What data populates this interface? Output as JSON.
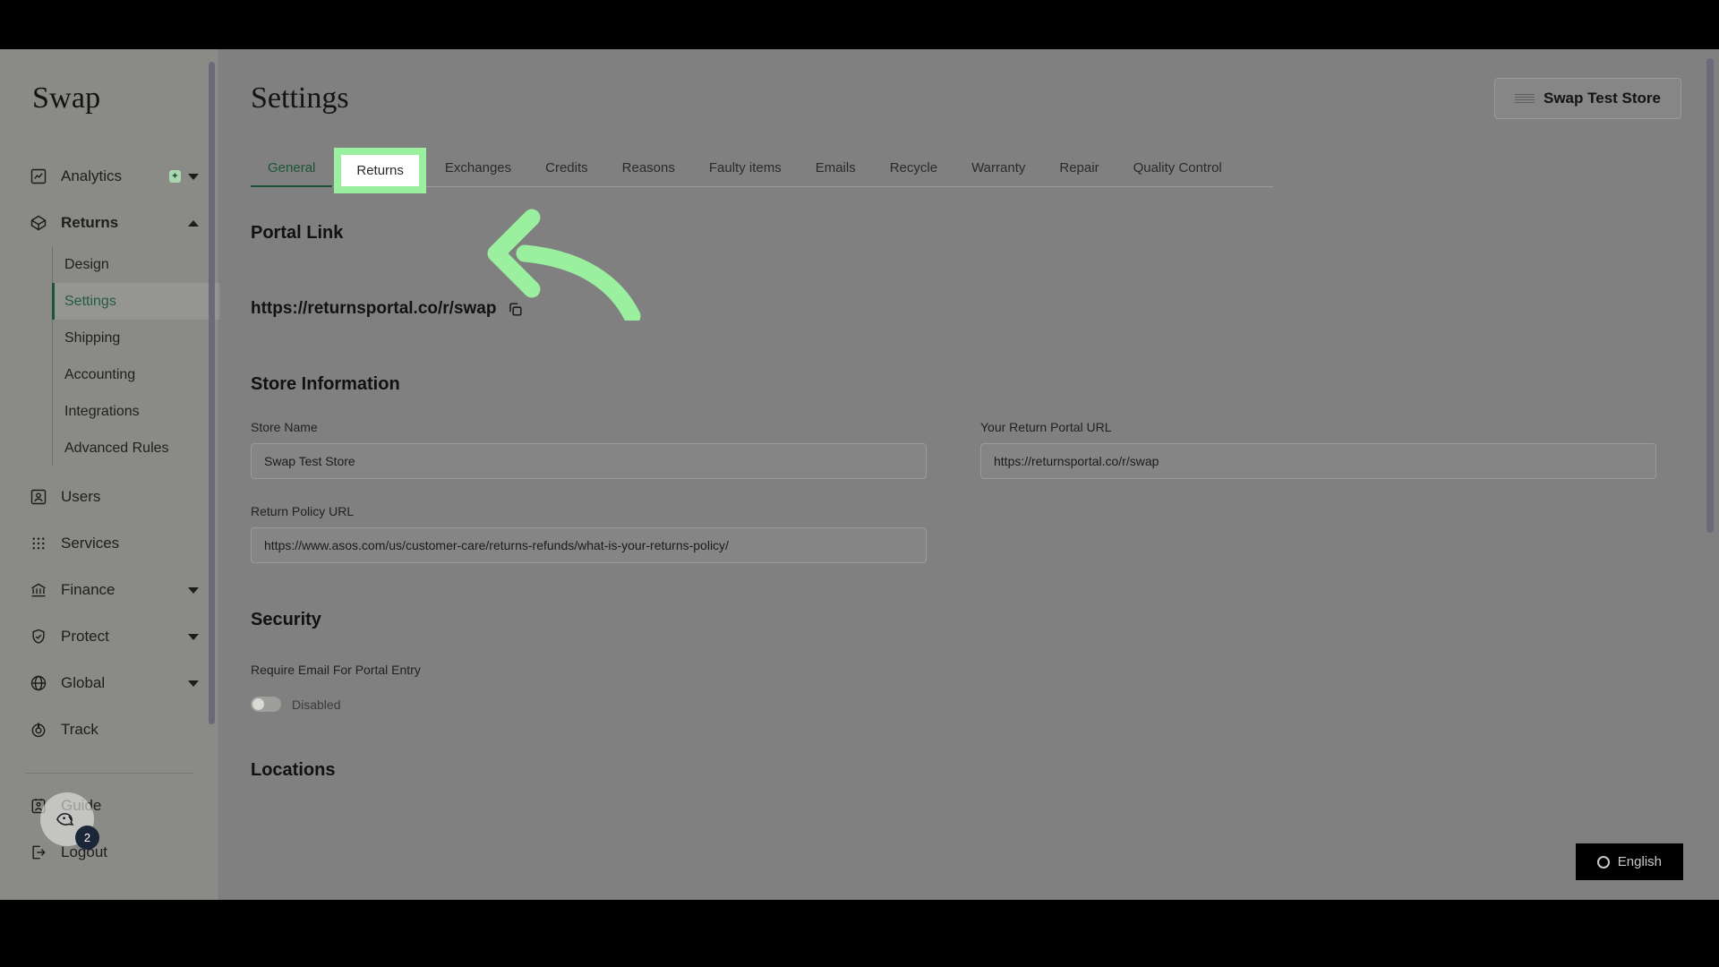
{
  "app": {
    "brand": "Swap"
  },
  "sidebar": {
    "items": [
      {
        "label": "Analytics",
        "icon": "chart-icon",
        "badge": "sparkle",
        "expandable": true,
        "expanded": false,
        "bold": false
      },
      {
        "label": "Returns",
        "icon": "package-icon",
        "expandable": true,
        "expanded": true,
        "bold": true
      }
    ],
    "returns_submenu": [
      {
        "label": "Design",
        "active": false
      },
      {
        "label": "Settings",
        "active": true
      },
      {
        "label": "Shipping",
        "active": false
      },
      {
        "label": "Accounting",
        "active": false
      },
      {
        "label": "Integrations",
        "active": false
      },
      {
        "label": "Advanced Rules",
        "active": false
      }
    ],
    "items_lower": [
      {
        "label": "Users",
        "icon": "user-card-icon",
        "expandable": false
      },
      {
        "label": "Services",
        "icon": "grid-dots-icon",
        "expandable": false
      },
      {
        "label": "Finance",
        "icon": "bank-icon",
        "expandable": true
      },
      {
        "label": "Protect",
        "icon": "shield-check-icon",
        "expandable": true
      },
      {
        "label": "Global",
        "icon": "globe-icon",
        "expandable": true
      },
      {
        "label": "Track",
        "icon": "track-icon",
        "expandable": false
      }
    ],
    "bottom_items": [
      {
        "label": "Guide",
        "icon": "guide-icon"
      },
      {
        "label": "Logout",
        "icon": "logout-icon"
      }
    ]
  },
  "header": {
    "title": "Settings",
    "store_button_label": "Swap Test Store"
  },
  "tabs": [
    {
      "label": "General",
      "active": true,
      "highlight": false
    },
    {
      "label": "Returns",
      "active": false,
      "highlight": true
    },
    {
      "label": "Exchanges",
      "active": false,
      "highlight": false
    },
    {
      "label": "Credits",
      "active": false,
      "highlight": false
    },
    {
      "label": "Reasons",
      "active": false,
      "highlight": false
    },
    {
      "label": "Faulty items",
      "active": false,
      "highlight": false
    },
    {
      "label": "Emails",
      "active": false,
      "highlight": false
    },
    {
      "label": "Recycle",
      "active": false,
      "highlight": false
    },
    {
      "label": "Warranty",
      "active": false,
      "highlight": false
    },
    {
      "label": "Repair",
      "active": false,
      "highlight": false
    },
    {
      "label": "Quality Control",
      "active": false,
      "highlight": false
    }
  ],
  "main": {
    "portal_link": {
      "heading": "Portal Link",
      "url": "https://returnsportal.co/r/swap",
      "copy_icon": "copy-icon"
    },
    "store_information": {
      "heading": "Store Information",
      "fields": [
        {
          "label": "Store Name",
          "value": "Swap Test Store"
        },
        {
          "label": "Your Return Portal URL",
          "value": "https://returnsportal.co/r/swap"
        },
        {
          "label": "Return Policy URL",
          "value": "https://www.asos.com/us/customer-care/returns-refunds/what-is-your-returns-policy/"
        }
      ]
    },
    "security": {
      "heading": "Security",
      "toggle_label": "Require Email For Portal Entry",
      "toggle_state": "Disabled"
    },
    "locations": {
      "heading": "Locations"
    }
  },
  "widgets": {
    "chat": {
      "badge_count": "2",
      "icon": "chat-face-icon"
    },
    "language": {
      "label": "English",
      "icon": "globe-ring-icon"
    }
  },
  "annotation": {
    "arrow_color": "#9bf0a0",
    "highlight_color": "#9bf0a0",
    "points_to": "Returns"
  },
  "colors": {
    "accent_green": "#1d5436",
    "sidebar_bg": "#8a8a87",
    "page_bg": "#808080"
  }
}
